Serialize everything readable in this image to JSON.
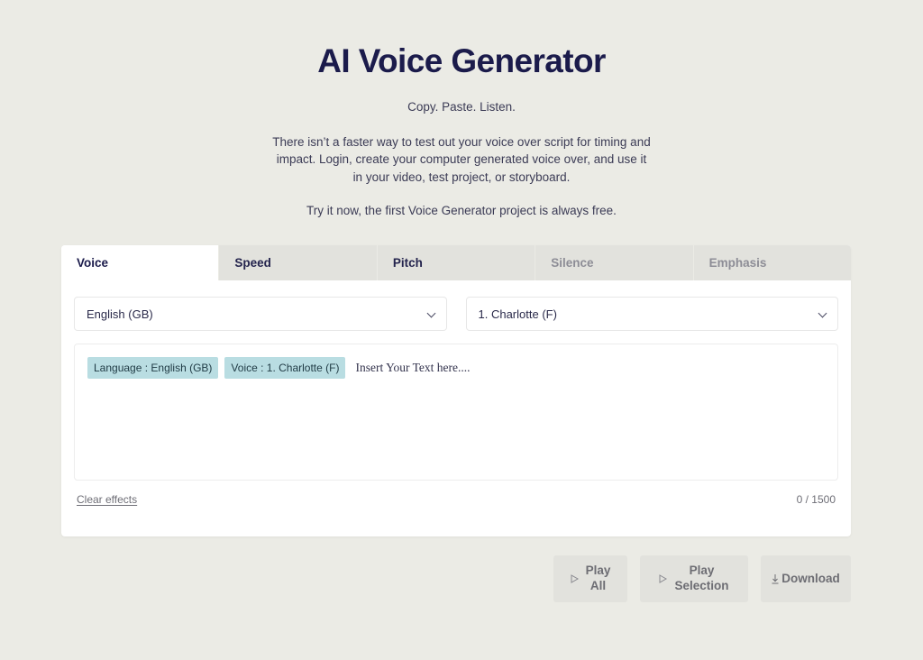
{
  "hero": {
    "title": "AI Voice Generator",
    "subtitle": "Copy. Paste. Listen.",
    "paragraph1": "There isn’t a faster way to test out your voice over script for timing and impact. Login, create your computer generated voice over, and use it in your video, test project, or storyboard.",
    "paragraph2": "Try it now, the first Voice Generator project is always free."
  },
  "tabs": [
    {
      "label": "Voice",
      "state": "active"
    },
    {
      "label": "Speed",
      "state": "enabled"
    },
    {
      "label": "Pitch",
      "state": "enabled"
    },
    {
      "label": "Silence",
      "state": "disabled"
    },
    {
      "label": "Emphasis",
      "state": "disabled"
    }
  ],
  "selects": {
    "language": {
      "value": "English (GB)",
      "icon": "chevron-down-icon"
    },
    "voice": {
      "value": "1. Charlotte (F)",
      "icon": "chevron-down-icon"
    }
  },
  "editor": {
    "tags": [
      "Language : English (GB)",
      "Voice : 1. Charlotte (F)"
    ],
    "placeholder": "Insert Your Text here...."
  },
  "footer": {
    "clear_label": "Clear effects",
    "counter": "0 / 1500"
  },
  "buttons": {
    "play_all": {
      "line1": "Play",
      "line2": "All",
      "icon": "play-icon"
    },
    "play_selection": {
      "line1": "Play",
      "line2": "Selection",
      "icon": "play-icon"
    },
    "download": {
      "label": "Download",
      "icon": "download-icon"
    }
  },
  "colors": {
    "page_background": "#ebebe5",
    "card_background": "#ffffff",
    "tab_inactive": "#e2e2dd",
    "title": "#1b1b4b",
    "tag_background": "#b9dde2",
    "button_background": "#e2e2dd",
    "muted_text": "#8d8d96"
  }
}
